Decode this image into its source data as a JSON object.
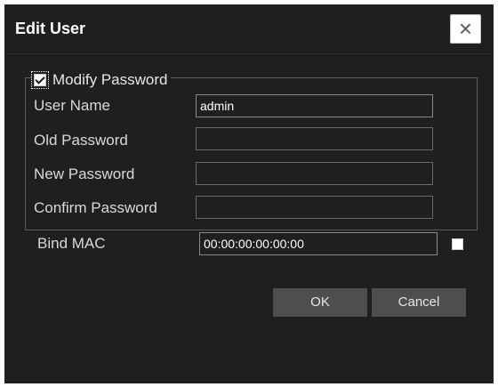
{
  "dialog": {
    "title": "Edit User",
    "close_glyph": "×"
  },
  "password_group": {
    "modify_password_label": "Modify Password",
    "modify_password_checked": true
  },
  "fields": {
    "user_name": {
      "label": "User Name",
      "value": "admin"
    },
    "old_password": {
      "label": "Old Password",
      "value": ""
    },
    "new_password": {
      "label": "New Password",
      "value": ""
    },
    "confirm_password": {
      "label": "Confirm Password",
      "value": ""
    },
    "bind_mac": {
      "label": "Bind MAC",
      "value": "00:00:00:00:00:00",
      "checked": false
    }
  },
  "buttons": {
    "ok_label": "OK",
    "cancel_label": "Cancel"
  },
  "colors": {
    "background": "#1f1f1f",
    "button": "#4e4e4e"
  },
  "icons": {
    "close": "close-icon",
    "check": "check-icon"
  }
}
